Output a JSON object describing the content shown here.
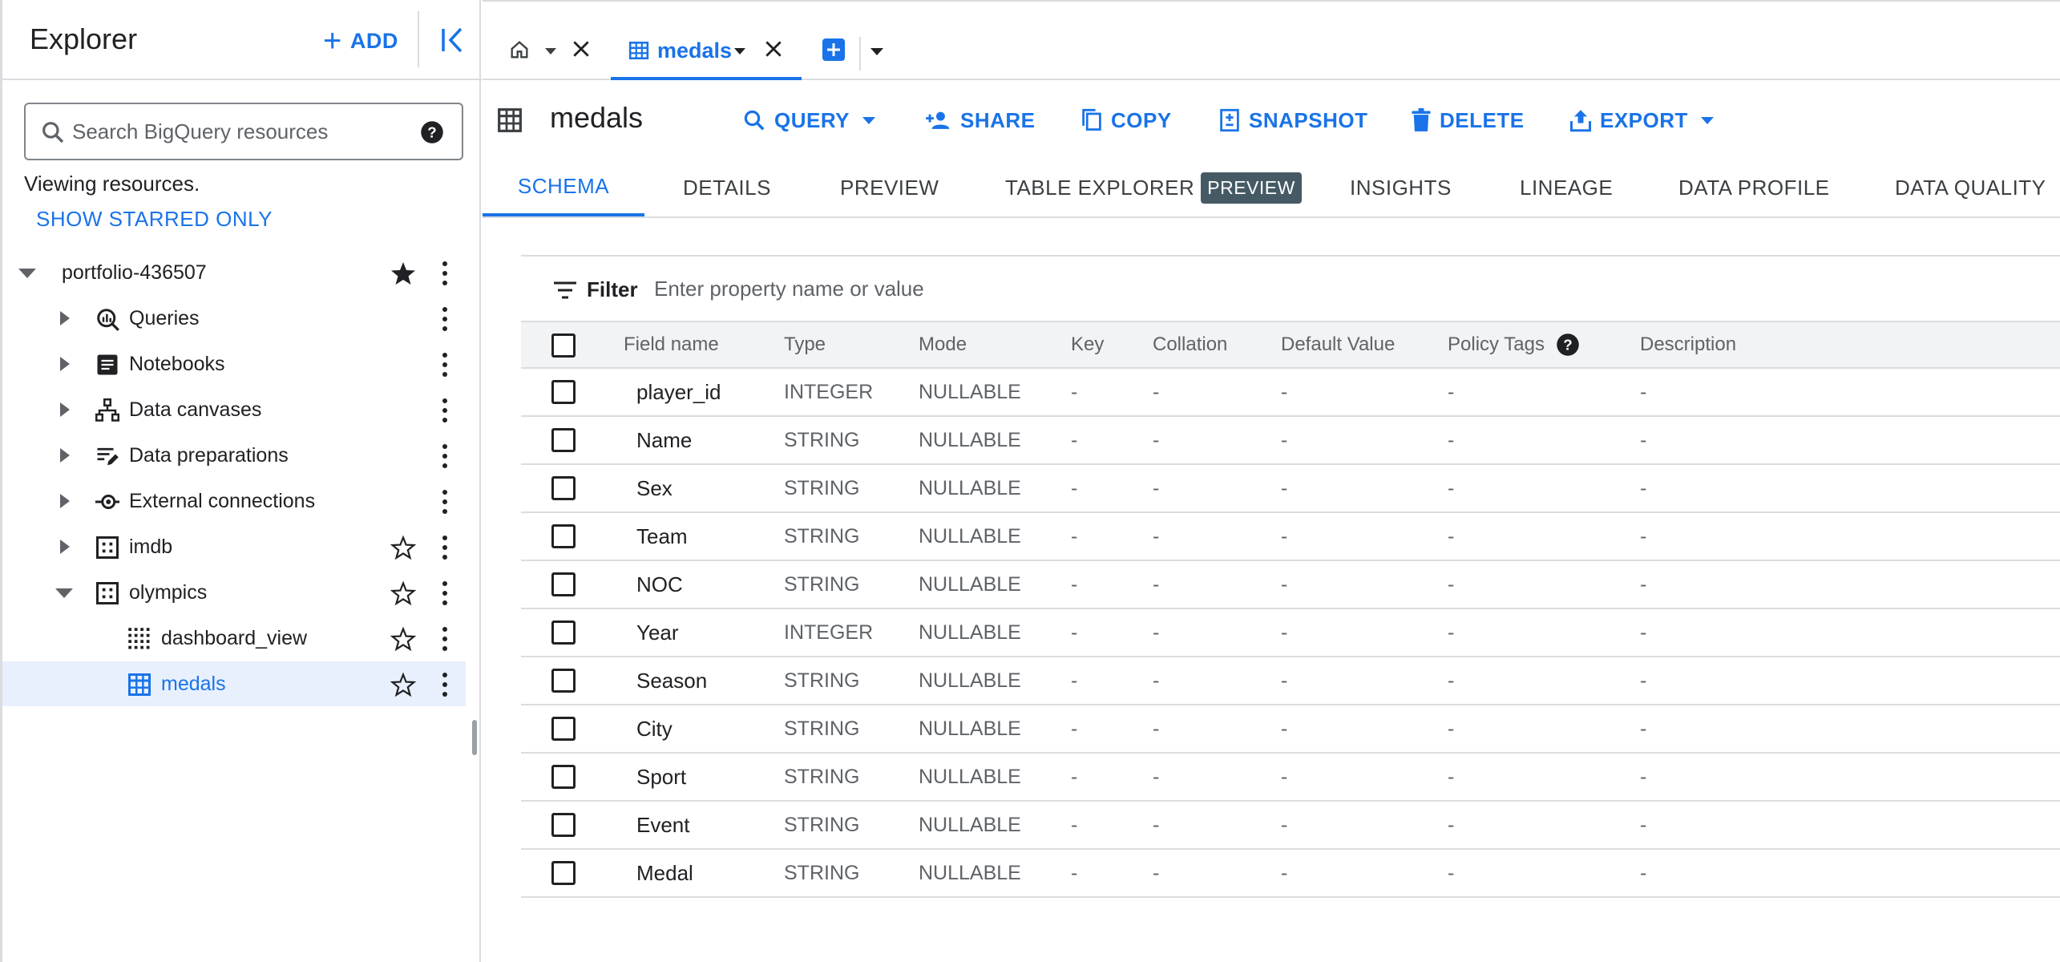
{
  "explorer": {
    "title": "Explorer",
    "add_label": "ADD",
    "search_placeholder": "Search BigQuery resources",
    "viewing_text": "Viewing resources.",
    "starred_link": "SHOW STARRED ONLY",
    "tree": [
      {
        "label": "portfolio-436507",
        "level": 0,
        "expanded": true,
        "icon": "none",
        "starred": true
      },
      {
        "label": "Queries",
        "level": 1,
        "expanded": false,
        "icon": "queries-icon",
        "starred": null
      },
      {
        "label": "Notebooks",
        "level": 1,
        "expanded": false,
        "icon": "notebook-icon",
        "starred": null
      },
      {
        "label": "Data canvases",
        "level": 1,
        "expanded": false,
        "icon": "data-canvas-icon",
        "starred": null
      },
      {
        "label": "Data preparations",
        "level": 1,
        "expanded": false,
        "icon": "data-preparation-icon",
        "starred": null
      },
      {
        "label": "External connections",
        "level": 1,
        "expanded": false,
        "icon": "external-connection-icon",
        "starred": null
      },
      {
        "label": "imdb",
        "level": 1,
        "expanded": false,
        "icon": "dataset-icon",
        "starred": false
      },
      {
        "label": "olympics",
        "level": 1,
        "expanded": true,
        "icon": "dataset-icon",
        "starred": false
      },
      {
        "label": "dashboard_view",
        "level": 2,
        "expanded": null,
        "icon": "view-icon",
        "starred": false
      },
      {
        "label": "medals",
        "level": 2,
        "expanded": null,
        "icon": "table-icon",
        "starred": false,
        "selected": true
      }
    ]
  },
  "tabs": {
    "home_icon": "home-icon",
    "active_tab_label": "medals"
  },
  "toolbar": {
    "title": "medals",
    "buttons": {
      "query": "QUERY",
      "share": "SHARE",
      "copy": "COPY",
      "snapshot": "SNAPSHOT",
      "delete": "DELETE",
      "export": "EXPORT"
    }
  },
  "subtabs": {
    "schema": "SCHEMA",
    "details": "DETAILS",
    "preview": "PREVIEW",
    "table_explorer": "TABLE EXPLORER",
    "table_explorer_badge": "PREVIEW",
    "insights": "INSIGHTS",
    "lineage": "LINEAGE",
    "data_profile": "DATA PROFILE",
    "data_quality": "DATA QUALITY"
  },
  "schema": {
    "filter_label": "Filter",
    "filter_placeholder": "Enter property name or value",
    "headers": {
      "field_name": "Field name",
      "type": "Type",
      "mode": "Mode",
      "key": "Key",
      "collation": "Collation",
      "default_value": "Default Value",
      "policy_tags": "Policy Tags",
      "description": "Description"
    },
    "rows": [
      {
        "name": "player_id",
        "type": "INTEGER",
        "mode": "NULLABLE",
        "key": "-",
        "collation": "-",
        "default": "-",
        "policy": "-",
        "description": "-"
      },
      {
        "name": "Name",
        "type": "STRING",
        "mode": "NULLABLE",
        "key": "-",
        "collation": "-",
        "default": "-",
        "policy": "-",
        "description": "-"
      },
      {
        "name": "Sex",
        "type": "STRING",
        "mode": "NULLABLE",
        "key": "-",
        "collation": "-",
        "default": "-",
        "policy": "-",
        "description": "-"
      },
      {
        "name": "Team",
        "type": "STRING",
        "mode": "NULLABLE",
        "key": "-",
        "collation": "-",
        "default": "-",
        "policy": "-",
        "description": "-"
      },
      {
        "name": "NOC",
        "type": "STRING",
        "mode": "NULLABLE",
        "key": "-",
        "collation": "-",
        "default": "-",
        "policy": "-",
        "description": "-"
      },
      {
        "name": "Year",
        "type": "INTEGER",
        "mode": "NULLABLE",
        "key": "-",
        "collation": "-",
        "default": "-",
        "policy": "-",
        "description": "-"
      },
      {
        "name": "Season",
        "type": "STRING",
        "mode": "NULLABLE",
        "key": "-",
        "collation": "-",
        "default": "-",
        "policy": "-",
        "description": "-"
      },
      {
        "name": "City",
        "type": "STRING",
        "mode": "NULLABLE",
        "key": "-",
        "collation": "-",
        "default": "-",
        "policy": "-",
        "description": "-"
      },
      {
        "name": "Sport",
        "type": "STRING",
        "mode": "NULLABLE",
        "key": "-",
        "collation": "-",
        "default": "-",
        "policy": "-",
        "description": "-"
      },
      {
        "name": "Event",
        "type": "STRING",
        "mode": "NULLABLE",
        "key": "-",
        "collation": "-",
        "default": "-",
        "policy": "-",
        "description": "-"
      },
      {
        "name": "Medal",
        "type": "STRING",
        "mode": "NULLABLE",
        "key": "-",
        "collation": "-",
        "default": "-",
        "policy": "-",
        "description": "-"
      }
    ]
  },
  "colors": {
    "accent": "#1a73e8",
    "selected_row": "#e8f0fe",
    "badge": "#455a64"
  }
}
